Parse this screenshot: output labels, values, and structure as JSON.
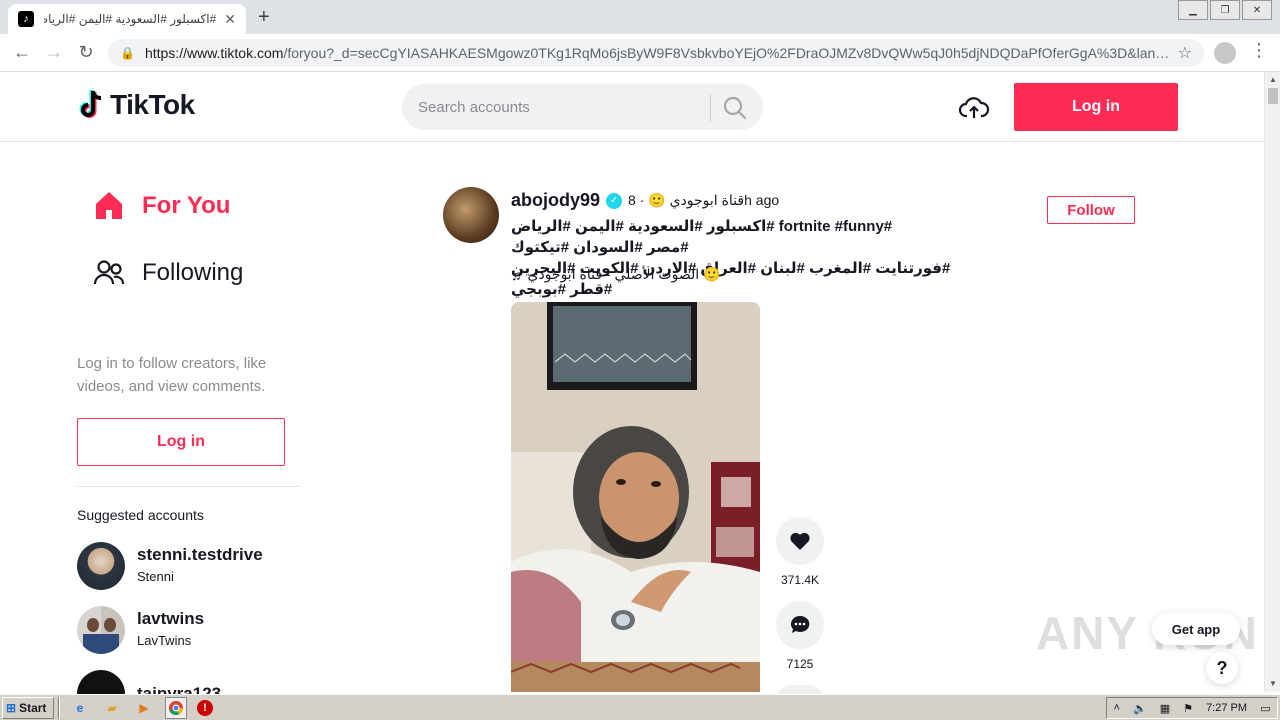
{
  "browser": {
    "tab_title": "#اكسبلور #السعودية #اليمن #الرياض",
    "url_host": "https://www.tiktok.com",
    "url_path": "/foryou?_d=secCgYIASAHKAESMgowz0TKg1RqMo6jsByW9F8VsbkvboYEjO%2FDraOJMZv8DvQWw5qJ0h5djNDQDaPfOferGgA%3D&langua..."
  },
  "header": {
    "logo_text": "TikTok",
    "search_placeholder": "Search accounts",
    "login_label": "Log in"
  },
  "sidebar": {
    "nav": [
      {
        "label": "For You",
        "icon": "home-icon"
      },
      {
        "label": "Following",
        "icon": "people-icon"
      }
    ],
    "hint": "Log in to follow creators, like videos, and view comments.",
    "login_label": "Log in",
    "suggested_title": "Suggested accounts",
    "suggested": [
      {
        "name": "stenni.testdrive",
        "sub": "Stenni"
      },
      {
        "name": "lavtwins",
        "sub": "LavTwins"
      },
      {
        "name": "taipyra123",
        "sub": ""
      }
    ]
  },
  "post": {
    "username": "abojody99",
    "nickname": "قناة ابوجودي 🙂 · 8h ago",
    "caption_line1": "#fortnite #funny #اكسبلور #السعودية #اليمن #الرياض",
    "caption_line2": "#مصر #السودان #تيكتوك",
    "caption_line3": "#فورتنايت #المغرب #لبنان #العراق #الاردن #الكويت #البحرين #قطر #بوبجي",
    "music": "الصوت الأصلي - قناة ابوجودي 🙂",
    "follow_label": "Follow",
    "likes": "371.4K",
    "comments": "7125"
  },
  "floating": {
    "get_app": "Get app",
    "help": "?",
    "watermark": "ANY RUN"
  },
  "taskbar": {
    "start_label": "Start",
    "clock": "7:27 PM"
  },
  "colors": {
    "brand": "#fe2c55",
    "verified": "#20d5ec"
  }
}
